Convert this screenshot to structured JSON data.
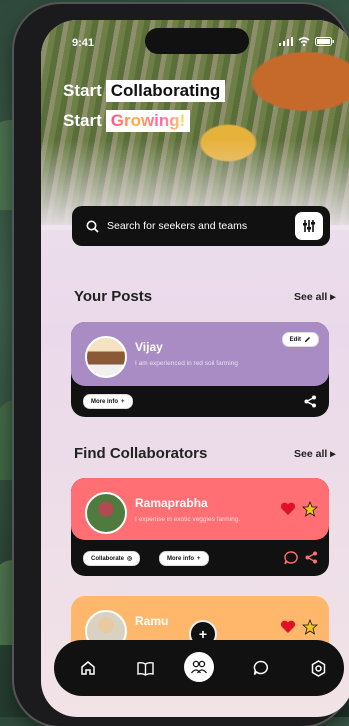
{
  "status": {
    "time": "9:41"
  },
  "hero": {
    "line1_prefix": "Start",
    "line1_highlight": "Collaborating",
    "line2_prefix": "Start",
    "line2_highlight": "Growing!"
  },
  "search": {
    "placeholder": "Search for seekers and teams"
  },
  "your_posts": {
    "title": "Your Posts",
    "see_all": "See all",
    "post": {
      "name": "Vijay",
      "description": "I am experienced in red soil farming",
      "edit_label": "Edit",
      "more_info_label": "More info"
    }
  },
  "collaborators": {
    "title": "Find Collaborators",
    "see_all": "See all",
    "items": [
      {
        "name": "Ramaprabha",
        "description": "I expertise in exotic veggies farming.",
        "collaborate_label": "Collaborate",
        "more_info_label": "More info",
        "color": "#ff6f73"
      },
      {
        "name": "Ramu",
        "description": "",
        "color": "#ffb86b"
      }
    ]
  },
  "colors": {
    "post_card": "#a98cc4",
    "collab_card_1": "#ff6f73",
    "collab_card_2": "#ffb86b",
    "heart": "#e0102a",
    "star": "#f5c518"
  },
  "bottom_nav": {
    "items": [
      "home-icon",
      "book-icon",
      "people-icon",
      "chat-icon",
      "settings-icon"
    ],
    "fab": "+"
  }
}
